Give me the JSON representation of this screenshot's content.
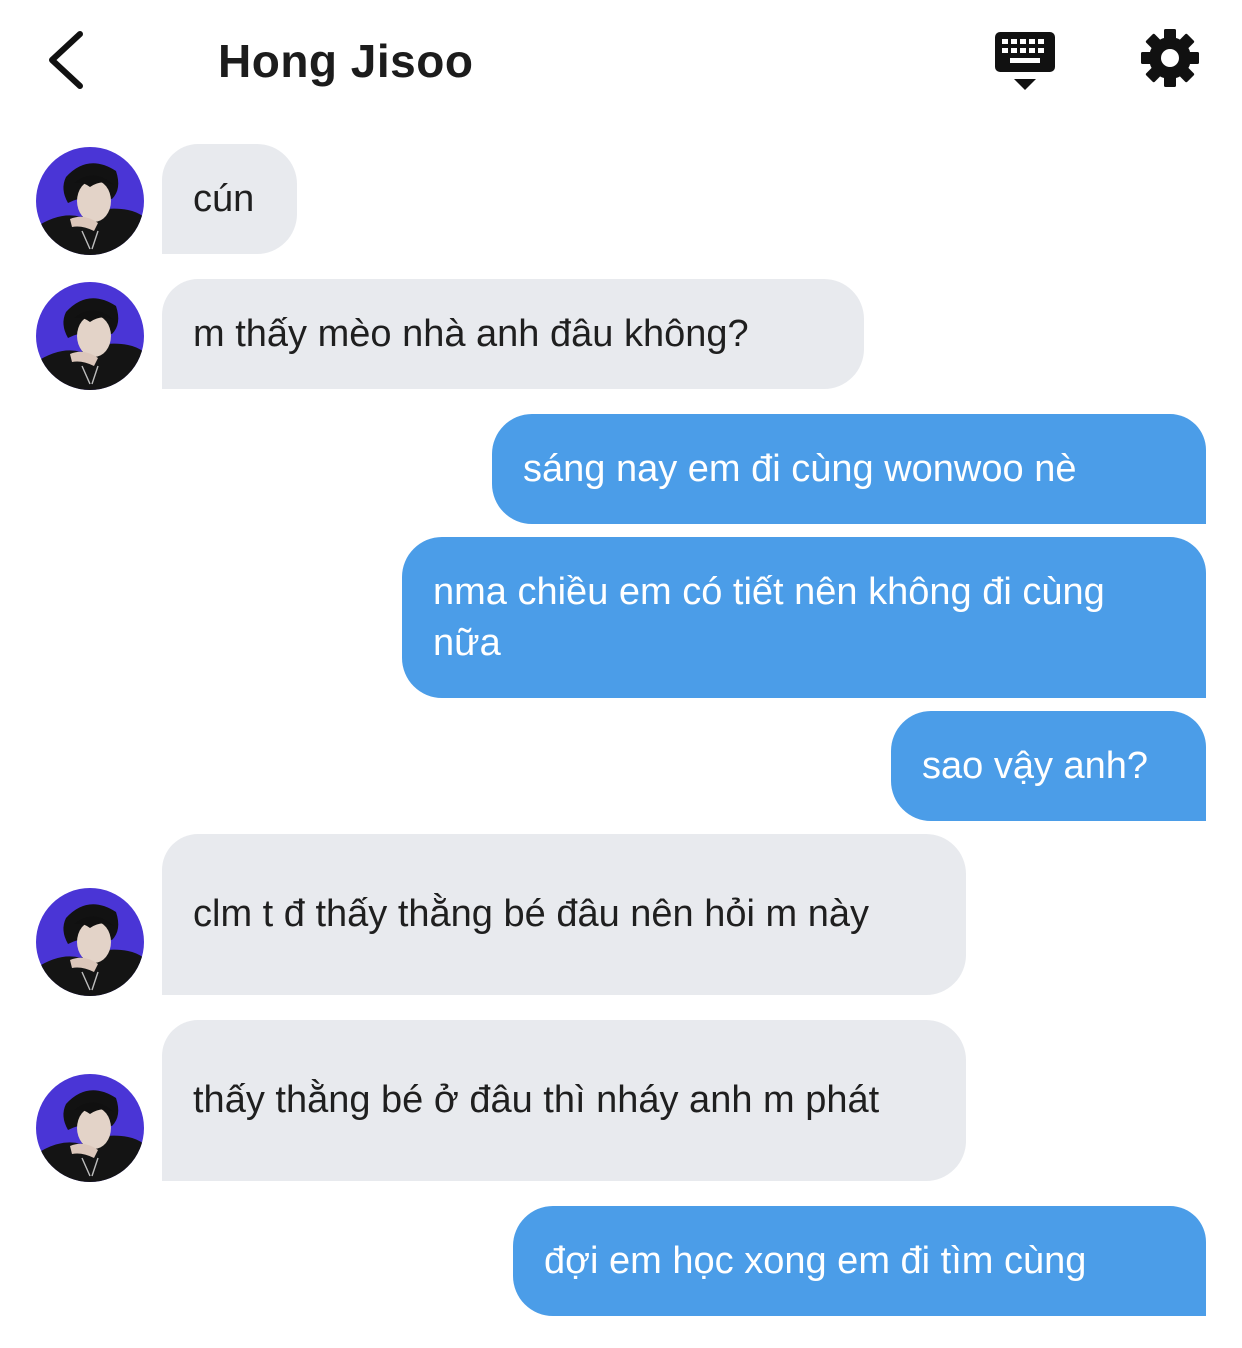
{
  "header": {
    "title": "Hong Jisoo",
    "icons": [
      "back-chevron-icon",
      "keyboard-icon",
      "gear-icon"
    ]
  },
  "contact": {
    "avatar": "contact-avatar-photo"
  },
  "colors": {
    "incoming_bubble": "#e8eaee",
    "outgoing_bubble": "#4b9de8",
    "avatar_bg": "#4a35d6"
  },
  "messages": [
    {
      "side": "incoming",
      "text": "cún"
    },
    {
      "side": "incoming",
      "text": "m thấy mèo nhà anh đâu không?"
    },
    {
      "side": "outgoing",
      "text": "sáng nay em đi cùng wonwoo nè"
    },
    {
      "side": "outgoing",
      "text": "nma chiều em có tiết nên không đi cùng nữa"
    },
    {
      "side": "outgoing",
      "text": "sao vậy anh?"
    },
    {
      "side": "incoming",
      "text": "clm t đ thấy thằng bé đâu nên hỏi m này"
    },
    {
      "side": "incoming",
      "text": "thấy thằng bé ở đâu thì nháy anh m phát"
    },
    {
      "side": "outgoing",
      "text": "đợi em học xong em đi tìm cùng"
    }
  ]
}
